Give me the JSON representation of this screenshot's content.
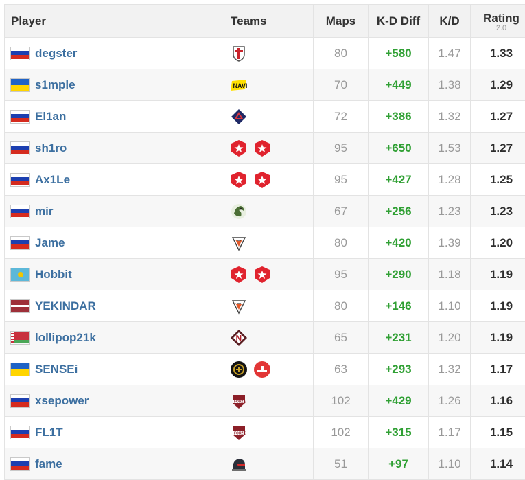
{
  "table": {
    "headers": {
      "player": "Player",
      "teams": "Teams",
      "maps": "Maps",
      "kd_diff": "K-D Diff",
      "kd": "K/D",
      "rating": "Rating",
      "rating_version": "2.0"
    },
    "rows": [
      {
        "player": "degster",
        "flag": "russia",
        "teams": [
          "team-spirit-shield-logo"
        ],
        "maps": "80",
        "kd_diff": "+580",
        "kd": "1.47",
        "rating": "1.33"
      },
      {
        "player": "s1mple",
        "flag": "ukraine",
        "teams": [
          "navi-logo"
        ],
        "maps": "70",
        "kd_diff": "+449",
        "kd": "1.38",
        "rating": "1.29"
      },
      {
        "player": "El1an",
        "flag": "russia",
        "teams": [
          "entropiq-logo"
        ],
        "maps": "72",
        "kd_diff": "+386",
        "kd": "1.32",
        "rating": "1.27"
      },
      {
        "player": "sh1ro",
        "flag": "russia",
        "teams": [
          "gambit-logo",
          "gambit-logo"
        ],
        "maps": "95",
        "kd_diff": "+650",
        "kd": "1.53",
        "rating": "1.27"
      },
      {
        "player": "Ax1Le",
        "flag": "russia",
        "teams": [
          "gambit-logo",
          "gambit-logo"
        ],
        "maps": "95",
        "kd_diff": "+427",
        "kd": "1.28",
        "rating": "1.25"
      },
      {
        "player": "mir",
        "flag": "russia",
        "teams": [
          "spirit-dragon-logo"
        ],
        "maps": "67",
        "kd_diff": "+256",
        "kd": "1.23",
        "rating": "1.23"
      },
      {
        "player": "Jame",
        "flag": "russia",
        "teams": [
          "virtus-pro-logo"
        ],
        "maps": "80",
        "kd_diff": "+420",
        "kd": "1.39",
        "rating": "1.20"
      },
      {
        "player": "Hobbit",
        "flag": "kazakhstan",
        "teams": [
          "gambit-logo",
          "gambit-logo"
        ],
        "maps": "95",
        "kd_diff": "+290",
        "kd": "1.18",
        "rating": "1.19"
      },
      {
        "player": "YEKINDAR",
        "flag": "latvia",
        "teams": [
          "virtus-pro-logo"
        ],
        "maps": "80",
        "kd_diff": "+146",
        "kd": "1.10",
        "rating": "1.19"
      },
      {
        "player": "lollipop21k",
        "flag": "belarus",
        "teams": [
          "nemiga-logo"
        ],
        "maps": "65",
        "kd_diff": "+231",
        "kd": "1.20",
        "rating": "1.19"
      },
      {
        "player": "SENSEi",
        "flag": "ukraine",
        "teams": [
          "black-round-logo",
          "red-round-logo"
        ],
        "maps": "63",
        "kd_diff": "+293",
        "kd": "1.32",
        "rating": "1.17"
      },
      {
        "player": "xsepower",
        "flag": "russia",
        "teams": [
          "forze-logo"
        ],
        "maps": "102",
        "kd_diff": "+429",
        "kd": "1.26",
        "rating": "1.16"
      },
      {
        "player": "FL1T",
        "flag": "russia",
        "teams": [
          "forze-logo"
        ],
        "maps": "102",
        "kd_diff": "+315",
        "kd": "1.17",
        "rating": "1.15"
      },
      {
        "player": "fame",
        "flag": "russia",
        "teams": [
          "helmet-logo"
        ],
        "maps": "51",
        "kd_diff": "+97",
        "kd": "1.10",
        "rating": "1.14"
      }
    ]
  },
  "colors": {
    "player_link": "#3c6fa0",
    "kd_diff_positive": "#30a034",
    "muted": "#999999",
    "header_bg": "#f2f2f2"
  }
}
